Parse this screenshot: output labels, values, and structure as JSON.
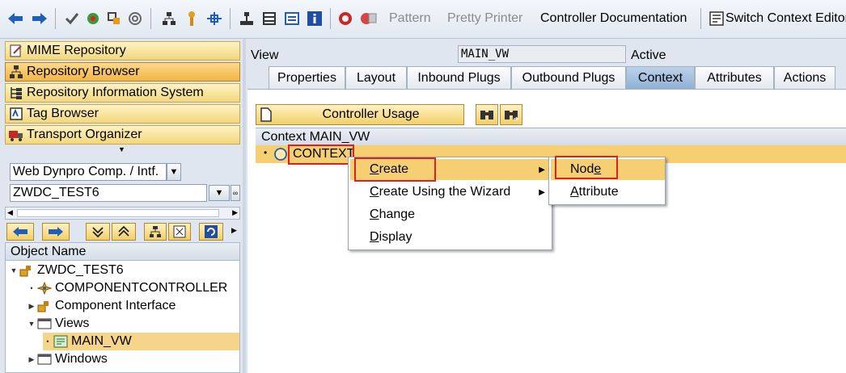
{
  "toolbar": {
    "pattern": "Pattern",
    "pretty_printer": "Pretty Printer",
    "controller_documentation": "Controller Documentation",
    "switch_context_editor": "Switch Context Editor"
  },
  "nav": {
    "mime_repository": "MIME Repository",
    "repository_browser": "Repository Browser",
    "repository_info_system": "Repository Information System",
    "tag_browser": "Tag Browser",
    "transport_organizer": "Transport Organizer"
  },
  "object_type": {
    "value": "Web Dynpro Comp. / Intf."
  },
  "object_name_input": {
    "value": "ZWDC_TEST6"
  },
  "tree": {
    "header": "Object Name",
    "root": "ZWDC_TEST6",
    "componentcontroller": "COMPONENTCONTROLLER",
    "component_interface": "Component Interface",
    "views": "Views",
    "main_vw": "MAIN_VW",
    "windows": "Windows"
  },
  "view": {
    "label": "View",
    "name": "MAIN_VW",
    "status": "Active"
  },
  "tabs": [
    "Properties",
    "Layout",
    "Inbound Plugs",
    "Outbound Plugs",
    "Context",
    "Attributes",
    "Actions"
  ],
  "context": {
    "controller_usage": "Controller Usage",
    "header": "Context MAIN_VW",
    "root_node": "CONTEXT"
  },
  "context_menu": {
    "create_u": "C",
    "create_rest": "reate",
    "wizard_u": "C",
    "wizard_rest": "reate Using the Wizard",
    "change_u": "C",
    "change_rest": "hange",
    "display_u": "D",
    "display_rest": "isplay"
  },
  "submenu": {
    "node_pre": "Nod",
    "node_u": "e",
    "attribute_u": "A",
    "attribute_rest": "ttribute"
  },
  "colors": {
    "highlight": "#f6cf73",
    "annotation_red": "#e02020",
    "tab_active": "#8fb2d6"
  }
}
